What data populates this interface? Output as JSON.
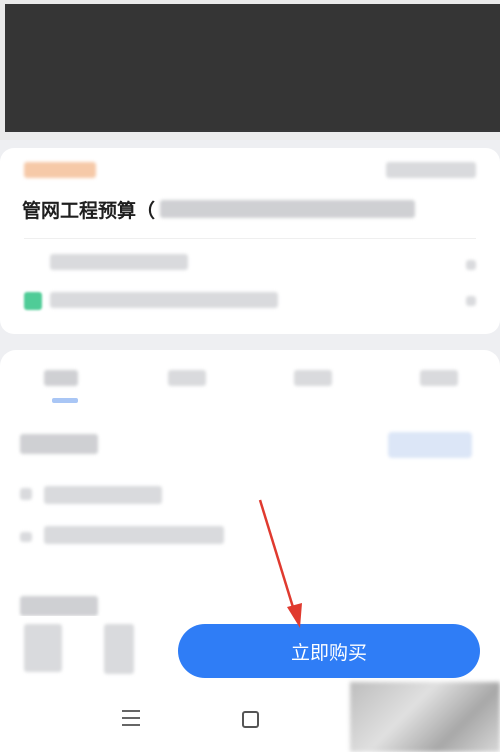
{
  "product": {
    "title": "管网工程预算（"
  },
  "action_bar": {
    "buy_label": "立即购买"
  },
  "colors": {
    "accent": "#2f7df6",
    "banner": "#353535",
    "arrow": "#e03a2f"
  },
  "icons": {
    "nav_menu": "menu-icon",
    "nav_home": "home-icon"
  }
}
